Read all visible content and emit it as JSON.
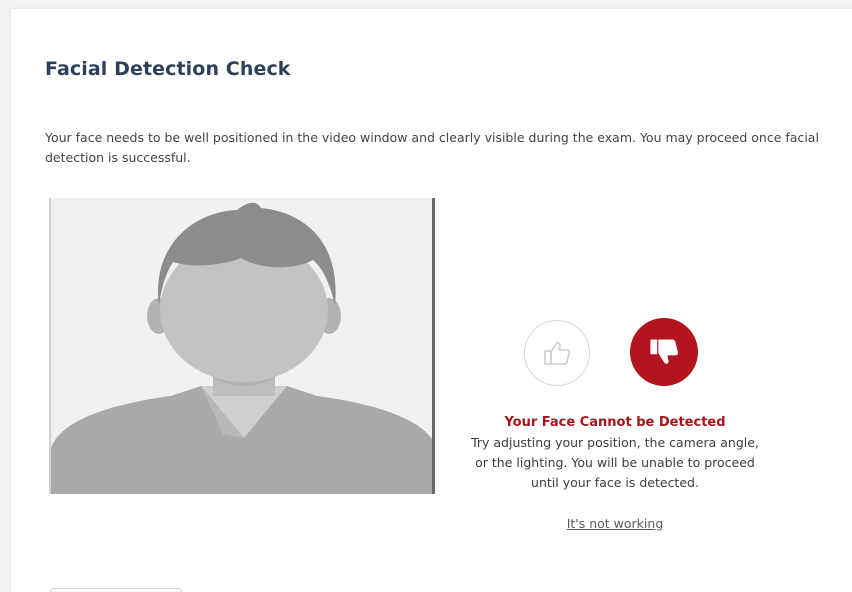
{
  "header": {
    "title": "Facial Detection Check"
  },
  "instructions": {
    "text": "Your face needs to be well positioned in the video window and clearly visible during the exam. You may proceed once facial detection is successful."
  },
  "detection": {
    "thumbs_up_icon": "thumbs-up-icon",
    "thumbs_down_icon": "thumbs-down-icon",
    "status_title": "Your Face Cannot be Detected",
    "status_message": "Try adjusting your position, the camera angle, or the lighting. You will be unable to proceed until your face is detected.",
    "help_link": "It's not working"
  },
  "colors": {
    "title": "#2c4159",
    "error": "#b3121f",
    "error_text": "#a3161d"
  }
}
